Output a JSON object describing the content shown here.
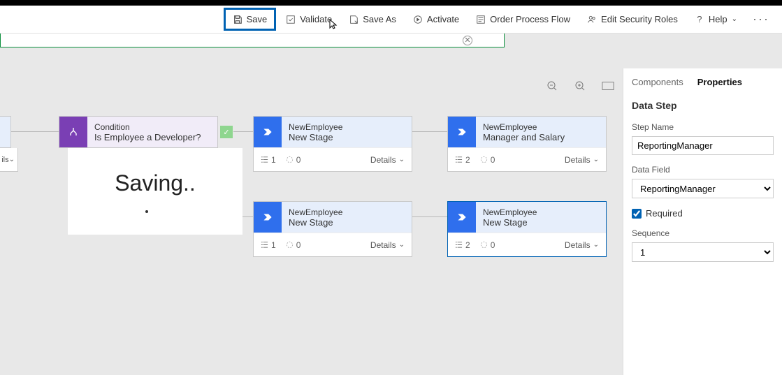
{
  "toolbar": {
    "save": "Save",
    "validate": "Validate",
    "saveAs": "Save As",
    "activate": "Activate",
    "orderFlow": "Order Process Flow",
    "editRoles": "Edit Security Roles",
    "help": "Help"
  },
  "canvas": {
    "partialDetails": "ils",
    "condition": {
      "t1": "Condition",
      "t2": "Is Employee a Developer?"
    },
    "stageA": {
      "t1": "NewEmployee",
      "t2": "New Stage",
      "count": "1",
      "branch": "0",
      "details": "Details"
    },
    "stageB": {
      "t1": "NewEmployee",
      "t2": "Manager and Salary",
      "count": "2",
      "branch": "0",
      "details": "Details"
    },
    "stageC": {
      "t1": "NewEmployee",
      "t2": "New Stage",
      "count": "1",
      "branch": "0",
      "details": "Details"
    },
    "stageD": {
      "t1": "NewEmployee",
      "t2": "New Stage",
      "count": "2",
      "branch": "0",
      "details": "Details"
    },
    "savingText": "Saving.."
  },
  "panel": {
    "tabComponents": "Components",
    "tabProperties": "Properties",
    "heading": "Data Step",
    "stepNameLabel": "Step Name",
    "stepNameValue": "ReportingManager",
    "dataFieldLabel": "Data Field",
    "dataFieldValue": "ReportingManager",
    "requiredLabel": "Required",
    "sequenceLabel": "Sequence",
    "sequenceValue": "1"
  }
}
